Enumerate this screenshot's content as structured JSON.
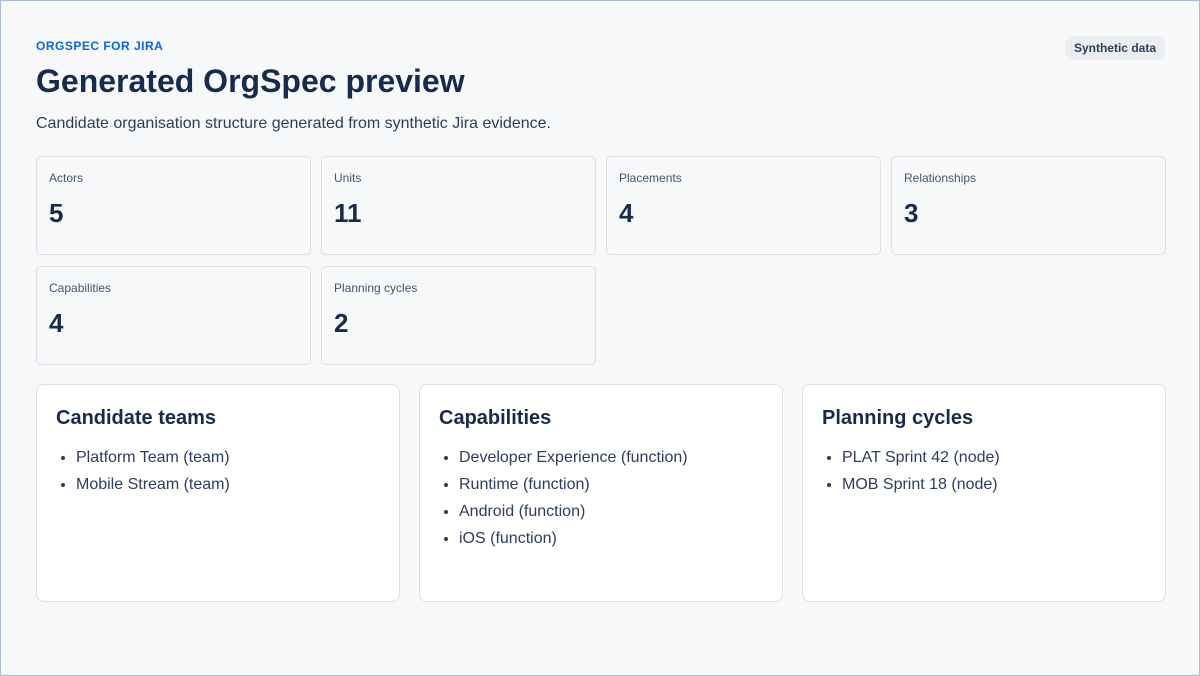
{
  "header": {
    "eyebrow": "ORGSPEC FOR JIRA",
    "title": "Generated OrgSpec preview",
    "subtitle": "Candidate organisation structure generated from synthetic Jira evidence.",
    "badge": "Synthetic data"
  },
  "metrics": [
    {
      "label": "Actors",
      "value": "5"
    },
    {
      "label": "Units",
      "value": "11"
    },
    {
      "label": "Placements",
      "value": "4"
    },
    {
      "label": "Relationships",
      "value": "3"
    },
    {
      "label": "Capabilities",
      "value": "4"
    },
    {
      "label": "Planning cycles",
      "value": "2"
    }
  ],
  "cards": [
    {
      "title": "Candidate teams",
      "items": [
        "Platform Team (team)",
        "Mobile Stream (team)"
      ]
    },
    {
      "title": "Capabilities",
      "items": [
        "Developer Experience (function)",
        "Runtime (function)",
        "Android (function)",
        "iOS (function)"
      ]
    },
    {
      "title": "Planning cycles",
      "items": [
        "PLAT Sprint 42 (node)",
        "MOB Sprint 18 (node)"
      ]
    }
  ],
  "colors": {
    "accent": "#0c66e4",
    "heading": "#172b4d",
    "background": "#f6f8fa"
  }
}
